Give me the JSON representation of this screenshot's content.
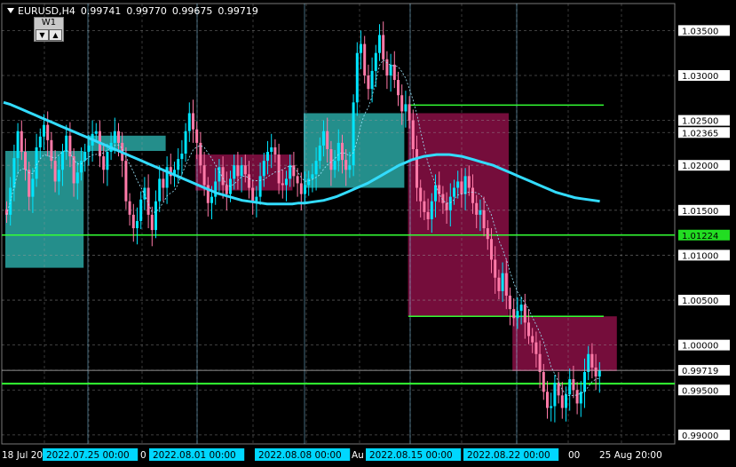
{
  "header": {
    "symbol_tf": "EURUSD,H4",
    "open": "0.99741",
    "high": "0.99770",
    "low": "0.99675",
    "close": "0.99719"
  },
  "timeframe_button": {
    "label": "W1",
    "down": "▼",
    "up": "▲"
  },
  "colors": {
    "background": "#000000",
    "bull_candle": "#00e5ff",
    "bear_candle": "#ff7aa8",
    "moving_average": "#33dcff",
    "level_line": "#33ff33",
    "bull_zone": "#2aa7a3",
    "bear_zone": "#8a0f45",
    "grid": "#9a9a9a",
    "price_label_bg": "#ffffff",
    "current_price_bg": "#22dd22",
    "time_label_bg": "#00d7ff"
  },
  "price_axis": {
    "labels": [
      "1.03500",
      "1.03000",
      "1.02500",
      "1.02365",
      "1.02000",
      "1.01500",
      "1.01224",
      "1.01000",
      "1.00500",
      "1.00000",
      "0.99719",
      "0.99500",
      "0.99000"
    ],
    "current_price": "1.01224",
    "bid_price": "0.99719"
  },
  "time_axis": {
    "labels": [
      "18 Jul 20",
      "2022.07.25 00:00",
      "0",
      "2022.08.01 00:00",
      "2022.08.08 00:00",
      "Au",
      "2022.08.15 00:00",
      "2022.08.22 00:00",
      "00",
      "25 Aug 20:00"
    ],
    "highlighted": [
      "2022.07.25 00:00",
      "2022.08.01 00:00",
      "2022.08.08 00:00",
      "2022.08.15 00:00",
      "2022.08.22 00:00"
    ]
  },
  "chart_data": {
    "type": "candlestick",
    "symbol": "EURUSD",
    "timeframe": "H4",
    "ylim": [
      0.989,
      1.038
    ],
    "horizontal_levels": [
      1.0267,
      1.01224,
      1.0032,
      0.9957
    ],
    "zones": [
      {
        "kind": "bull",
        "x_start": 0,
        "x_end": 21,
        "top": 1.0216,
        "bottom": 1.0086
      },
      {
        "kind": "bull",
        "x_start": 22,
        "x_end": 43,
        "top": 1.0233,
        "bottom": 1.0216
      },
      {
        "kind": "bear",
        "x_start": 51,
        "x_end": 77,
        "top": 1.0212,
        "bottom": 1.0172
      },
      {
        "kind": "bull",
        "x_start": 80,
        "x_end": 107,
        "top": 1.0258,
        "bottom": 1.0175
      },
      {
        "kind": "bear",
        "x_start": 108,
        "x_end": 135,
        "top": 1.0258,
        "bottom": 1.0032
      },
      {
        "kind": "bear",
        "x_start": 136,
        "x_end": 164,
        "top": 1.0032,
        "bottom": 0.9971
      }
    ],
    "close": [
      1.0145,
      1.0175,
      1.0208,
      1.0238,
      1.0215,
      1.0195,
      1.0165,
      1.0185,
      1.022,
      1.0232,
      1.0245,
      1.0228,
      1.0205,
      1.0182,
      1.0195,
      1.0215,
      1.0233,
      1.021,
      1.018,
      1.0192,
      1.0205,
      1.0215,
      1.0222,
      1.0235,
      1.0238,
      1.021,
      1.0195,
      1.0215,
      1.0225,
      1.0238,
      1.0225,
      1.0205,
      1.016,
      1.0145,
      1.013,
      1.0138,
      1.0162,
      1.0175,
      1.0145,
      1.0128,
      1.016,
      1.0185,
      1.0175,
      1.0198,
      1.0188,
      1.0195,
      1.0207,
      1.0213,
      1.0238,
      1.0258,
      1.024,
      1.0225,
      1.02,
      1.0178,
      1.0158,
      1.0165,
      1.0182,
      1.0198,
      1.0178,
      1.0168,
      1.0185,
      1.02,
      1.0188,
      1.02,
      1.019,
      1.0175,
      1.016,
      1.0165,
      1.0188,
      1.0205,
      1.0215,
      1.022,
      1.0212,
      1.018,
      1.0178,
      1.0185,
      1.02,
      1.0188,
      1.018,
      1.0168,
      1.0178,
      1.0185,
      1.019,
      1.0205,
      1.0222,
      1.0238,
      1.0218,
      1.0195,
      1.0205,
      1.0225,
      1.0206,
      1.0195,
      1.02,
      1.027,
      1.0325,
      1.0335,
      1.03,
      1.0285,
      1.0305,
      1.0325,
      1.0345,
      1.0318,
      1.03,
      1.0312,
      1.0295,
      1.0278,
      1.026,
      1.0268,
      1.025,
      1.0218,
      1.0175,
      1.016,
      1.0148,
      1.014,
      1.016,
      1.0178,
      1.0168,
      1.0158,
      1.015,
      1.0165,
      1.0175,
      1.0182,
      1.0168,
      1.0188,
      1.0175,
      1.0158,
      1.0145,
      1.015,
      1.013,
      1.0118,
      1.0095,
      1.0075,
      1.006,
      1.008,
      1.0055,
      1.004,
      1.003,
      1.0038,
      1.0045,
      1.0025,
      1.001,
      1.0003,
      0.999,
      0.997,
      0.9948,
      0.993,
      0.9932,
      0.9958,
      0.9944,
      0.993,
      0.9945,
      0.9962,
      0.995,
      0.9935,
      0.9948,
      0.997,
      0.999,
      0.9975,
      0.9965,
      0.9972
    ],
    "ma_slow": [
      1.027,
      1.0268,
      1.0265,
      1.0262,
      1.0259,
      1.0256,
      1.0253,
      1.025,
      1.0247,
      1.0244,
      1.0241,
      1.0238,
      1.0235,
      1.0232,
      1.0229,
      1.0226,
      1.0223,
      1.022,
      1.0217,
      1.0214,
      1.0211,
      1.0208,
      1.0205,
      1.0202,
      1.0199,
      1.0196,
      1.0193,
      1.019,
      1.0187,
      1.0184,
      1.0181,
      1.0178,
      1.0175,
      1.0172,
      1.0169,
      1.0167,
      1.0165,
      1.0163,
      1.0161,
      1.016,
      1.0159,
      1.0158,
      1.0157,
      1.0157,
      1.0157,
      1.0157,
      1.0157,
      1.0158,
      1.0158,
      1.0159,
      1.016,
      1.0161,
      1.0163,
      1.0165,
      1.0168,
      1.0171,
      1.0174,
      1.0177,
      1.018,
      1.0184,
      1.0188,
      1.0192,
      1.0196,
      1.02,
      1.0203,
      1.0206,
      1.0208,
      1.021,
      1.0211,
      1.0212,
      1.0212,
      1.0212,
      1.0211,
      1.021,
      1.0208,
      1.0206,
      1.0204,
      1.0202,
      1.02,
      1.0197,
      1.0194,
      1.0191,
      1.0188,
      1.0185,
      1.0182,
      1.0179,
      1.0176,
      1.0173,
      1.017,
      1.0168,
      1.0166,
      1.0164,
      1.0163,
      1.0162,
      1.0161,
      1.016
    ]
  }
}
